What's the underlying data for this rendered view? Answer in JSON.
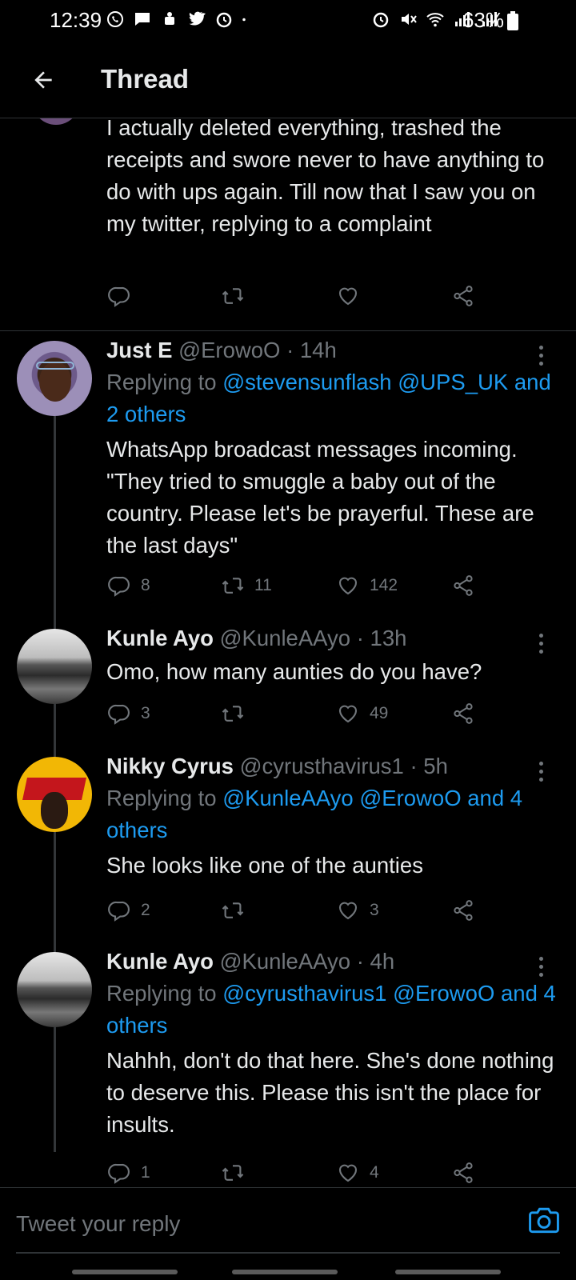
{
  "status_bar": {
    "time": "12:39",
    "battery": "63%",
    "left_icons": [
      "whatsapp-icon",
      "message-icon",
      "android-icon",
      "twitter-icon",
      "alarm-icon",
      "dot-icon"
    ],
    "right_icons": [
      "alarm-icon",
      "mute-icon",
      "wifi-icon",
      "signal-icon",
      "signal-icon",
      "battery-icon"
    ]
  },
  "header": {
    "title": "Thread",
    "back_icon": "arrow-left-icon"
  },
  "top_tweet": {
    "text": "I actually deleted everything, trashed the receipts and swore never to have anything to do with ups again. Till now that I saw you on my twitter, replying to a complaint",
    "reply_count": "",
    "retweet_count": "",
    "like_count": ""
  },
  "tweets": [
    {
      "name": "Just E",
      "handle": "@ErowoO",
      "dot": "·",
      "time": "14h",
      "replying_prefix": "Replying to ",
      "mentions": [
        "@stevensunflash",
        "@UPS_UK"
      ],
      "and_others": "and 2 others",
      "text": "WhatsApp broadcast messages incoming. \"They tried to smuggle a baby out of the country. Please let's be prayerful. These are the last days\"",
      "reply_count": "8",
      "retweet_count": "11",
      "like_count": "142"
    },
    {
      "name": "Kunle Ayo",
      "handle": "@KunleAAyo",
      "dot": "·",
      "time": "13h",
      "text": "Omo, how many aunties do you have?",
      "reply_count": "3",
      "retweet_count": "",
      "like_count": "49"
    },
    {
      "name": "Nikky Cyrus",
      "handle": "@cyrusthavirus1",
      "dot": "·",
      "time": "5h",
      "replying_prefix": "Replying to ",
      "mentions": [
        "@KunleAAyo",
        "@ErowoO"
      ],
      "and_others": "and 4 others",
      "text": "She looks like one of the aunties",
      "reply_count": "2",
      "retweet_count": "",
      "like_count": "3"
    },
    {
      "name": "Kunle Ayo",
      "handle": "@KunleAAyo",
      "dot": "·",
      "time": "4h",
      "replying_prefix": "Replying to ",
      "mentions": [
        "@cyrusthavirus1",
        "@ErowoO"
      ],
      "and_others": "and 4 others",
      "text": "Nahhh, don't do that here. She's done nothing to deserve this. Please this isn't the place for insults.",
      "reply_count": "1",
      "retweet_count": "",
      "like_count": "4"
    }
  ],
  "composer": {
    "placeholder": "Tweet your reply",
    "camera_icon": "camera-icon"
  },
  "colors": {
    "background": "#000000",
    "text": "#e7e9ea",
    "muted": "#71767b",
    "link": "#1d9bf0",
    "divider": "#2f3336"
  }
}
